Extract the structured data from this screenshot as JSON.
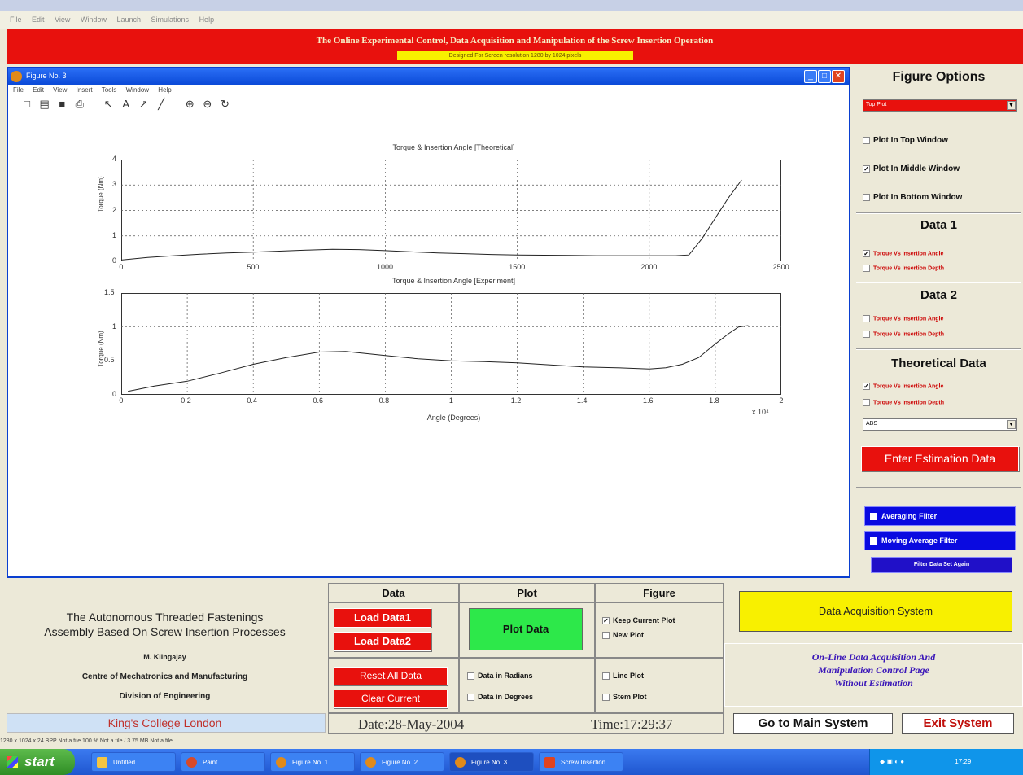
{
  "app": {
    "menu": [
      "File",
      "Edit",
      "View",
      "Window",
      "Launch",
      "Simulations",
      "Help"
    ],
    "banner_title": "The Online Experimental Control, Data Acquisition and Manipulation of the Screw Insertion Operation",
    "banner_subtitle": "Designed For Screen resolution 1280 by 1024 pixels"
  },
  "figure": {
    "title": "Figure No. 3",
    "menu": [
      "File",
      "Edit",
      "View",
      "Insert",
      "Tools",
      "Window",
      "Help"
    ],
    "toolbar": [
      "new-icon",
      "open-icon",
      "save-icon",
      "print-icon",
      "pointer-icon",
      "text-icon",
      "arrow-icon",
      "line-icon",
      "zoom-in-icon",
      "zoom-out-icon",
      "rotate-icon"
    ],
    "toolbar_glyphs": [
      "□",
      "▤",
      "■",
      "⎙",
      "↖",
      "A",
      "↗",
      "╱",
      "⊕",
      "⊖",
      "↻"
    ]
  },
  "chart_data": [
    {
      "type": "line",
      "title": "Torque & Insertion Angle [Theoretical]",
      "xlabel": "",
      "ylabel": "Torque (Nm)",
      "xlim": [
        0,
        2500
      ],
      "ylim": [
        0,
        4
      ],
      "xticks": [
        "0",
        "500",
        "1000",
        "1500",
        "2000",
        "2500"
      ],
      "yticks": [
        "0",
        "1",
        "2",
        "3",
        "4"
      ],
      "grid": true,
      "series": [
        {
          "x": [
            0,
            100,
            200,
            300,
            400,
            500,
            600,
            700,
            800,
            900,
            1000,
            1100,
            1200,
            1300,
            1400,
            1500,
            1600,
            1700,
            1800,
            1900,
            2000,
            2100,
            2150,
            2200,
            2250,
            2300,
            2350
          ],
          "y": [
            0.05,
            0.15,
            0.22,
            0.28,
            0.33,
            0.36,
            0.4,
            0.44,
            0.47,
            0.46,
            0.42,
            0.37,
            0.33,
            0.3,
            0.27,
            0.25,
            0.24,
            0.23,
            0.22,
            0.22,
            0.22,
            0.22,
            0.25,
            0.9,
            1.7,
            2.5,
            3.2
          ]
        }
      ]
    },
    {
      "type": "line",
      "title": "Torque & Insertion Angle [Experiment]",
      "xlabel": "Angle (Degrees)",
      "ylabel": "Torque (Nm)",
      "xlim": [
        0,
        2
      ],
      "ylim": [
        0,
        1.5
      ],
      "x_multiplier": "x 10⁴",
      "xticks": [
        "0",
        "0.2",
        "0.4",
        "0.6",
        "0.8",
        "1",
        "1.2",
        "1.4",
        "1.6",
        "1.8",
        "2"
      ],
      "yticks": [
        "0",
        "0.5",
        "1",
        "1.5"
      ],
      "grid": true,
      "series": [
        {
          "x": [
            0.02,
            0.1,
            0.2,
            0.3,
            0.4,
            0.5,
            0.6,
            0.68,
            0.8,
            0.9,
            1.0,
            1.1,
            1.2,
            1.3,
            1.4,
            1.5,
            1.6,
            1.65,
            1.7,
            1.75,
            1.8,
            1.84,
            1.87,
            1.9
          ],
          "y": [
            0.05,
            0.13,
            0.2,
            0.32,
            0.45,
            0.55,
            0.63,
            0.64,
            0.58,
            0.53,
            0.5,
            0.49,
            0.47,
            0.44,
            0.41,
            0.4,
            0.38,
            0.4,
            0.45,
            0.55,
            0.75,
            0.9,
            1.0,
            1.02
          ]
        }
      ]
    }
  ],
  "right_panel": {
    "figure_options_title": "Figure Options",
    "figure_select": "Top Plot",
    "plot_top": "Plot In Top Window",
    "plot_middle": "Plot In Middle Window",
    "plot_bottom": "Plot In Bottom Window",
    "data1_title": "Data 1",
    "data1_opt1": "Torque Vs Insertion Angle",
    "data1_opt2": "Torque Vs Insertion Depth",
    "data2_title": "Data 2",
    "data2_opt1": "Torque Vs Insertion Angle",
    "data2_opt2": "Torque Vs Insertion Depth",
    "theo_title": "Theoretical Data",
    "theo_opt1": "Torque Vs Insertion Angle",
    "theo_opt2": "Torque Vs Insertion Depth",
    "theo_select": "ABS",
    "enter_estimation": "Enter Estimation Data",
    "averaging_filter": "Averaging Filter",
    "moving_average_filter": "Moving Average Filter",
    "filter_again": "Filter Data Set Again"
  },
  "info": {
    "title_line1": "The Autonomous Threaded Fastenings",
    "title_line2": "Assembly Based On Screw Insertion Processes",
    "author": "M. Klingajay",
    "centre": "Centre of Mechatronics and Manufacturing",
    "division": "Division of Engineering",
    "college": "King's College London"
  },
  "data_panel": {
    "header": "Data",
    "load1": "Load Data1",
    "load2": "Load Data2",
    "reset": "Reset All Data",
    "clear": "Clear Current"
  },
  "plot_panel": {
    "header": "Plot",
    "plot_btn": "Plot Data",
    "radians": "Data in Radians",
    "degrees": "Data in Degrees"
  },
  "figure_panel": {
    "header": "Figure",
    "keep": "Keep Current Plot",
    "new": "New Plot",
    "line": "Line Plot",
    "stem": "Stem Plot"
  },
  "date_text": "Date:28-May-2004",
  "time_text": "Time:17:29:37",
  "daq_button": "Data Acquisition System",
  "page_caption_1": "On-Line Data Acquisition And",
  "page_caption_2": "Manipulation Control Page",
  "page_caption_3": "Without Estimation",
  "main_button": "Go to Main System",
  "exit_button": "Exit System",
  "statusbar": "1280 x 1024 x 24 BPP   Not a file   100 %   Not a file / 3.75 MB   Not a file",
  "taskbar": {
    "start": "start",
    "tasks": [
      "Untitled",
      "Paint",
      "Figure No. 1",
      "Figure No. 2",
      "Figure No. 3",
      "Screw Insertion"
    ],
    "clock": "17:29"
  },
  "colors": {
    "red": "#e8110d",
    "green": "#2de84a",
    "yellow": "#f8f000",
    "blue": "#0a0ae0"
  }
}
